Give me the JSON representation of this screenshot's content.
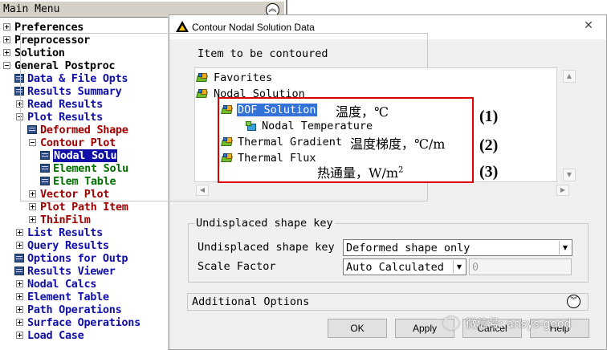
{
  "main_menu": {
    "title": "Main Menu",
    "items": [
      {
        "label": "Preferences"
      },
      {
        "label": "Preprocessor"
      },
      {
        "label": "Solution"
      },
      {
        "label": "General Postproc"
      },
      {
        "label": "Data & File Opts"
      },
      {
        "label": "Results Summary"
      },
      {
        "label": "Read Results"
      },
      {
        "label": "Plot Results"
      },
      {
        "label": "Deformed Shape"
      },
      {
        "label": "Contour Plot"
      },
      {
        "label": "Nodal Solu"
      },
      {
        "label": "Element Solu"
      },
      {
        "label": "Elem Table"
      },
      {
        "label": "Vector Plot"
      },
      {
        "label": "Plot Path Item"
      },
      {
        "label": "ThinFilm"
      },
      {
        "label": "List Results"
      },
      {
        "label": "Query Results"
      },
      {
        "label": "Options for Outp"
      },
      {
        "label": "Results Viewer"
      },
      {
        "label": "Nodal Calcs"
      },
      {
        "label": "Element Table"
      },
      {
        "label": "Path Operations"
      },
      {
        "label": "Surface Operations"
      },
      {
        "label": "Load Case"
      }
    ]
  },
  "dialog": {
    "title": "Contour Nodal Solution Data",
    "item_group_label": "Item to be contoured",
    "tree": [
      {
        "label": "Favorites"
      },
      {
        "label": "Nodal Solution"
      },
      {
        "label": "DOF Solution"
      },
      {
        "label": "Nodal Temperature"
      },
      {
        "label": "Thermal Gradient"
      },
      {
        "label": "Thermal Flux"
      }
    ],
    "undisplaced_group_label": "Undisplaced shape key",
    "undisplaced_label": "Undisplaced shape key",
    "undisplaced_value": "Deformed shape only",
    "scale_label": "Scale Factor",
    "scale_mode": "Auto Calculated",
    "scale_value": "0",
    "additional_options": "Additional Options",
    "buttons": {
      "ok": "OK",
      "apply": "Apply",
      "cancel": "Cancel",
      "help": "Help"
    }
  },
  "annotations": {
    "temperature": "温度，℃",
    "gradient": "温度梯度，℃/m",
    "flux_prefix": "热通量，W/m",
    "flux_exp": "2",
    "tags": [
      "(1)",
      "(2)",
      "(3)"
    ]
  },
  "watermark": "微信号: ansys-good",
  "colors": {
    "menu_blue": "#1010a8",
    "menu_red": "#a00000",
    "menu_green": "#007000",
    "selection": "#3373d8",
    "annotation_border": "#e00000"
  },
  "icons": [
    "circle-double-chevron-up",
    "ansys-logo",
    "close-x",
    "result-folder",
    "result-cube",
    "dropdown-arrow",
    "circle-double-chevron-down",
    "wechat-logo"
  ]
}
